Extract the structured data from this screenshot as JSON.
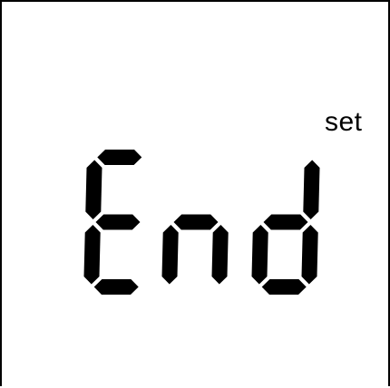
{
  "display": {
    "text": "End",
    "indicator_label": "set",
    "digits": [
      {
        "char": "E",
        "segments": [
          "a",
          "d",
          "e",
          "f",
          "g"
        ]
      },
      {
        "char": "n",
        "segments": [
          "c",
          "e",
          "g"
        ]
      },
      {
        "char": "d",
        "segments": [
          "b",
          "c",
          "d",
          "e",
          "g"
        ]
      }
    ],
    "segment_color": "#000000",
    "background_color": "#ffffff"
  }
}
